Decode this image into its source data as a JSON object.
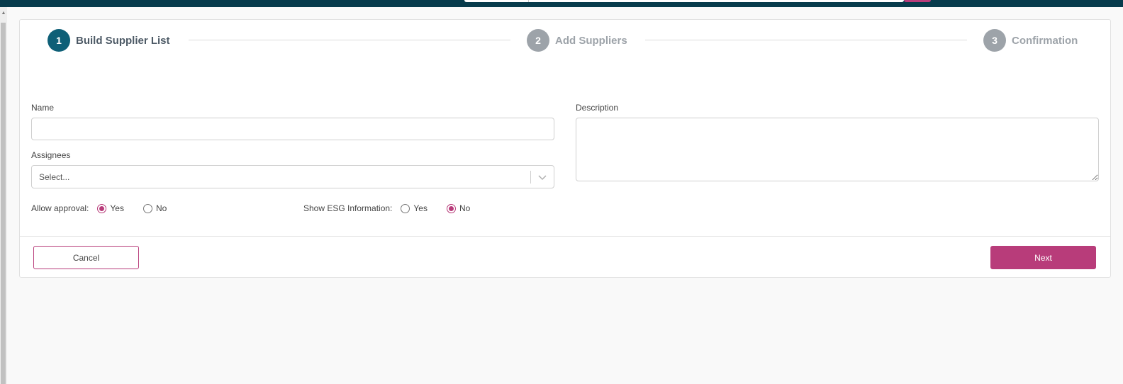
{
  "colors": {
    "primary": "#0e5f77",
    "accent": "#b83c7a",
    "inactive": "#9da3a9",
    "topbar": "#073b4c"
  },
  "stepper": {
    "steps": [
      {
        "number": "1",
        "label": "Build Supplier List",
        "state": "active"
      },
      {
        "number": "2",
        "label": "Add Suppliers",
        "state": "inactive"
      },
      {
        "number": "3",
        "label": "Confirmation",
        "state": "inactive"
      }
    ]
  },
  "form": {
    "name": {
      "label": "Name",
      "value": "",
      "placeholder": ""
    },
    "description": {
      "label": "Description",
      "value": "",
      "placeholder": ""
    },
    "assignees": {
      "label": "Assignees",
      "placeholder": "Select...",
      "icon": "chevron-down-icon"
    },
    "allow_approval": {
      "label": "Allow approval:",
      "options": [
        {
          "label": "Yes",
          "checked": true
        },
        {
          "label": "No",
          "checked": false
        }
      ]
    },
    "show_esg": {
      "label": "Show ESG Information:",
      "options": [
        {
          "label": "Yes",
          "checked": false
        },
        {
          "label": "No",
          "checked": true
        }
      ]
    }
  },
  "footer": {
    "cancel_label": "Cancel",
    "next_label": "Next"
  }
}
